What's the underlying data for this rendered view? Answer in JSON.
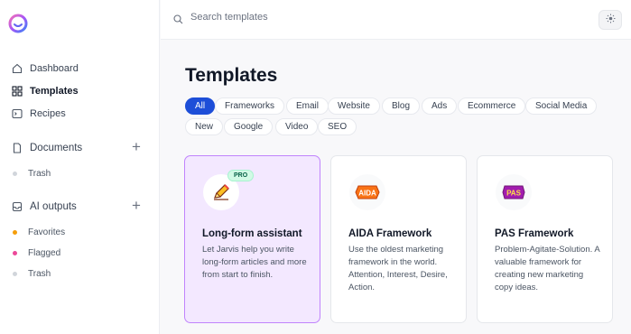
{
  "sidebar": {
    "nav": [
      {
        "label": "Dashboard",
        "icon": "home-icon"
      },
      {
        "label": "Templates",
        "icon": "grid-icon",
        "active": true
      },
      {
        "label": "Recipes",
        "icon": "terminal-icon"
      }
    ],
    "documents": {
      "title": "Documents",
      "items": [
        {
          "label": "Trash",
          "dot": "#d1d5db"
        }
      ]
    },
    "ai_outputs": {
      "title": "AI outputs",
      "items": [
        {
          "label": "Favorites",
          "dot": "#f59e0b"
        },
        {
          "label": "Flagged",
          "dot": "#ec4899"
        },
        {
          "label": "Trash",
          "dot": "#d1d5db"
        }
      ]
    }
  },
  "search": {
    "placeholder": "Search templates",
    "value": ""
  },
  "page": {
    "title": "Templates"
  },
  "filters": [
    "All",
    "Frameworks",
    "Email",
    "Website",
    "Blog",
    "Ads",
    "Ecommerce",
    "Social Media",
    "New",
    "Google",
    "Video",
    "SEO"
  ],
  "active_filter": "All",
  "cards": [
    {
      "title": "Long-form assistant",
      "desc": "Let Jarvis help you write long-form articles and more from start to finish.",
      "badge": "PRO",
      "icon": "pencil-icon"
    },
    {
      "title": "AIDA Framework",
      "desc": "Use the oldest marketing framework in the world. Attention, Interest, Desire, Action.",
      "logo_text": "AIDA",
      "icon": "aida-logo-icon"
    },
    {
      "title": "PAS Framework",
      "desc": "Problem-Agitate-Solution. A valuable framework for creating new marketing copy ideas.",
      "logo_text": "PAS",
      "icon": "pas-logo-icon"
    }
  ],
  "colors": {
    "accent": "#1d4ed8",
    "selected_card_bg": "#f3e8ff",
    "selected_card_border": "#c084fc"
  }
}
